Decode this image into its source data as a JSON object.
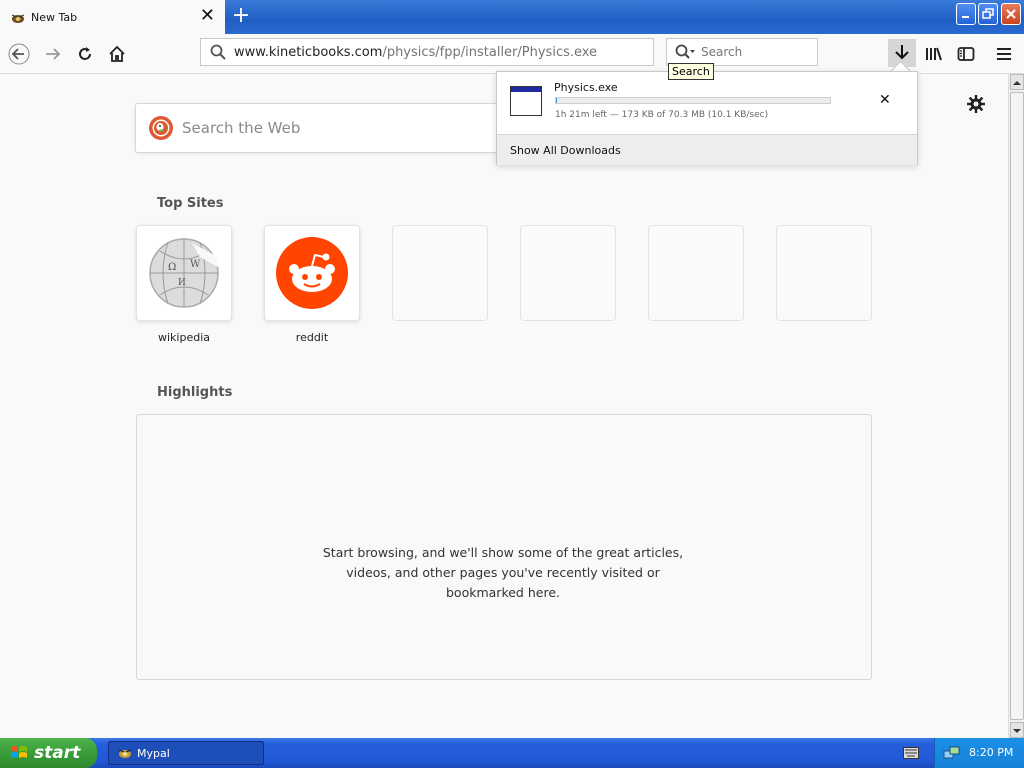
{
  "browser": {
    "tab_title": "New Tab",
    "url_host": "www.kineticbooks.com",
    "url_path": "/physics/fpp/installer/Physics.exe",
    "search_placeholder": "Search",
    "tooltip": "Search"
  },
  "download_panel": {
    "file_name": "Physics.exe",
    "progress": 0.003,
    "status": "1h 21m left — 173 KB of 70.3 MB (10.1 KB/sec)",
    "footer": "Show All Downloads"
  },
  "newtab": {
    "search_placeholder": "Search the Web",
    "top_sites_title": "Top Sites",
    "sites": [
      {
        "label": "wikipedia"
      },
      {
        "label": "reddit"
      }
    ],
    "highlights_title": "Highlights",
    "highlights_message": "Start browsing, and we'll show some of the great articles, videos, and other pages you've recently visited or bookmarked here."
  },
  "taskbar": {
    "start_label": "start",
    "task_label": "Mypal",
    "clock": "8:20 PM"
  },
  "colors": {
    "accent": "#3b8fe0",
    "reddit": "#ff4500",
    "taskbar": "#245edb"
  }
}
